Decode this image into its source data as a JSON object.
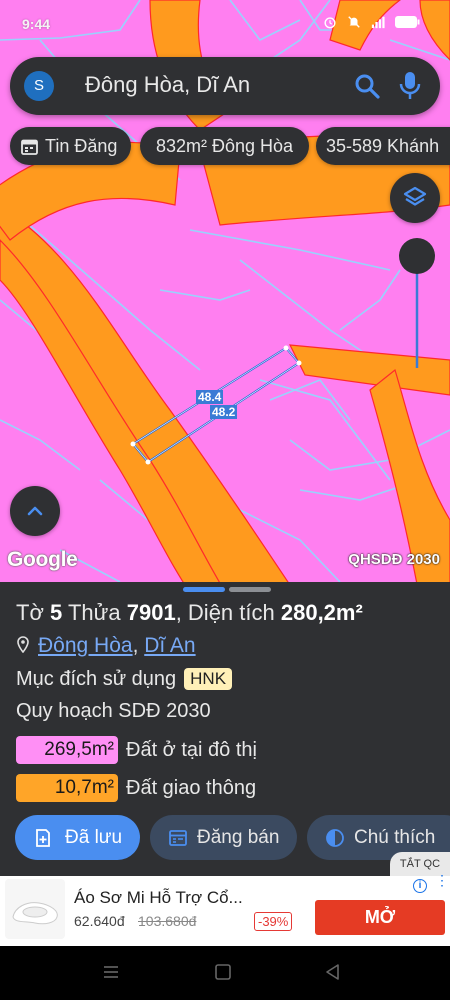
{
  "status_bar": {
    "time": "9:44",
    "battery": "84"
  },
  "search": {
    "avatar_letter": "S",
    "query": "Đông Hòa, Dĩ An"
  },
  "chips": [
    {
      "label": "Tin Đăng"
    },
    {
      "label": "832m² Đông Hòa"
    },
    {
      "label": "35-589 Khánh"
    }
  ],
  "map": {
    "measure_1": "48.4",
    "measure_2": "48.2",
    "attribution": "Google",
    "layer_label": "QHSDĐ 2030"
  },
  "parcel": {
    "sheet_label": "Tờ",
    "sheet_no": "5",
    "plot_label": "Thửa",
    "plot_no": "7901",
    "area_label": ", Diện tích",
    "area_value": "280,2m²",
    "ward": "Đông Hòa",
    "city": "Dĩ An",
    "purpose_label": "Mục đích sử dụng",
    "purpose_code": "HNK",
    "planning_label": "Quy hoạch SDĐ 2030",
    "zones": [
      {
        "area": "269,5m²",
        "label": "Đất ở tại đô thị",
        "color": "#ff8ff5"
      },
      {
        "area": "10,7m²",
        "label": "Đất giao thông",
        "color": "#ffa528"
      }
    ]
  },
  "actions": {
    "saved": "Đã lưu",
    "sell": "Đăng bán",
    "like": "Chú thích"
  },
  "ad": {
    "hide_label": "TẮT QC",
    "title": "Áo Sơ Mi Hỗ Trợ Cổ...",
    "price": "62.640đ",
    "old_price": "103.680đ",
    "discount": "-39%",
    "cta": "MỞ"
  }
}
